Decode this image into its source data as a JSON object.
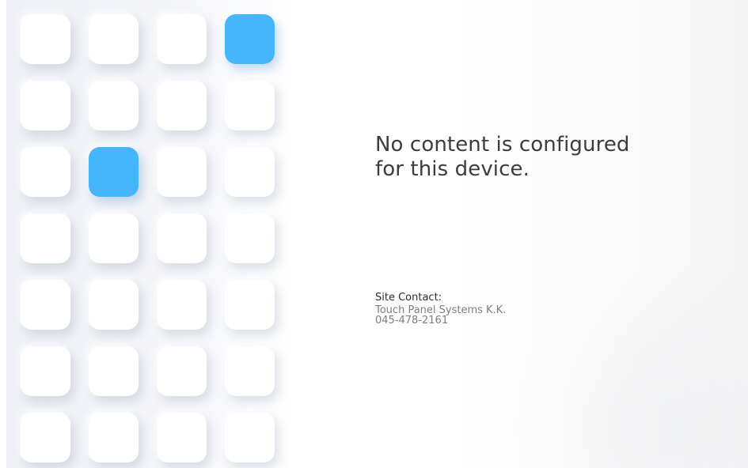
{
  "grid": {
    "columns": 4,
    "rows": 7,
    "active_tiles": [
      3,
      9
    ],
    "active_color": "#45b6fb",
    "tile_color": "#ffffff"
  },
  "message": {
    "line1": "No content is configured",
    "line2": "for this device."
  },
  "contact": {
    "title": "Site Contact:",
    "company": "Touch Panel Systems K.K.",
    "phone": "045-478-2161"
  }
}
